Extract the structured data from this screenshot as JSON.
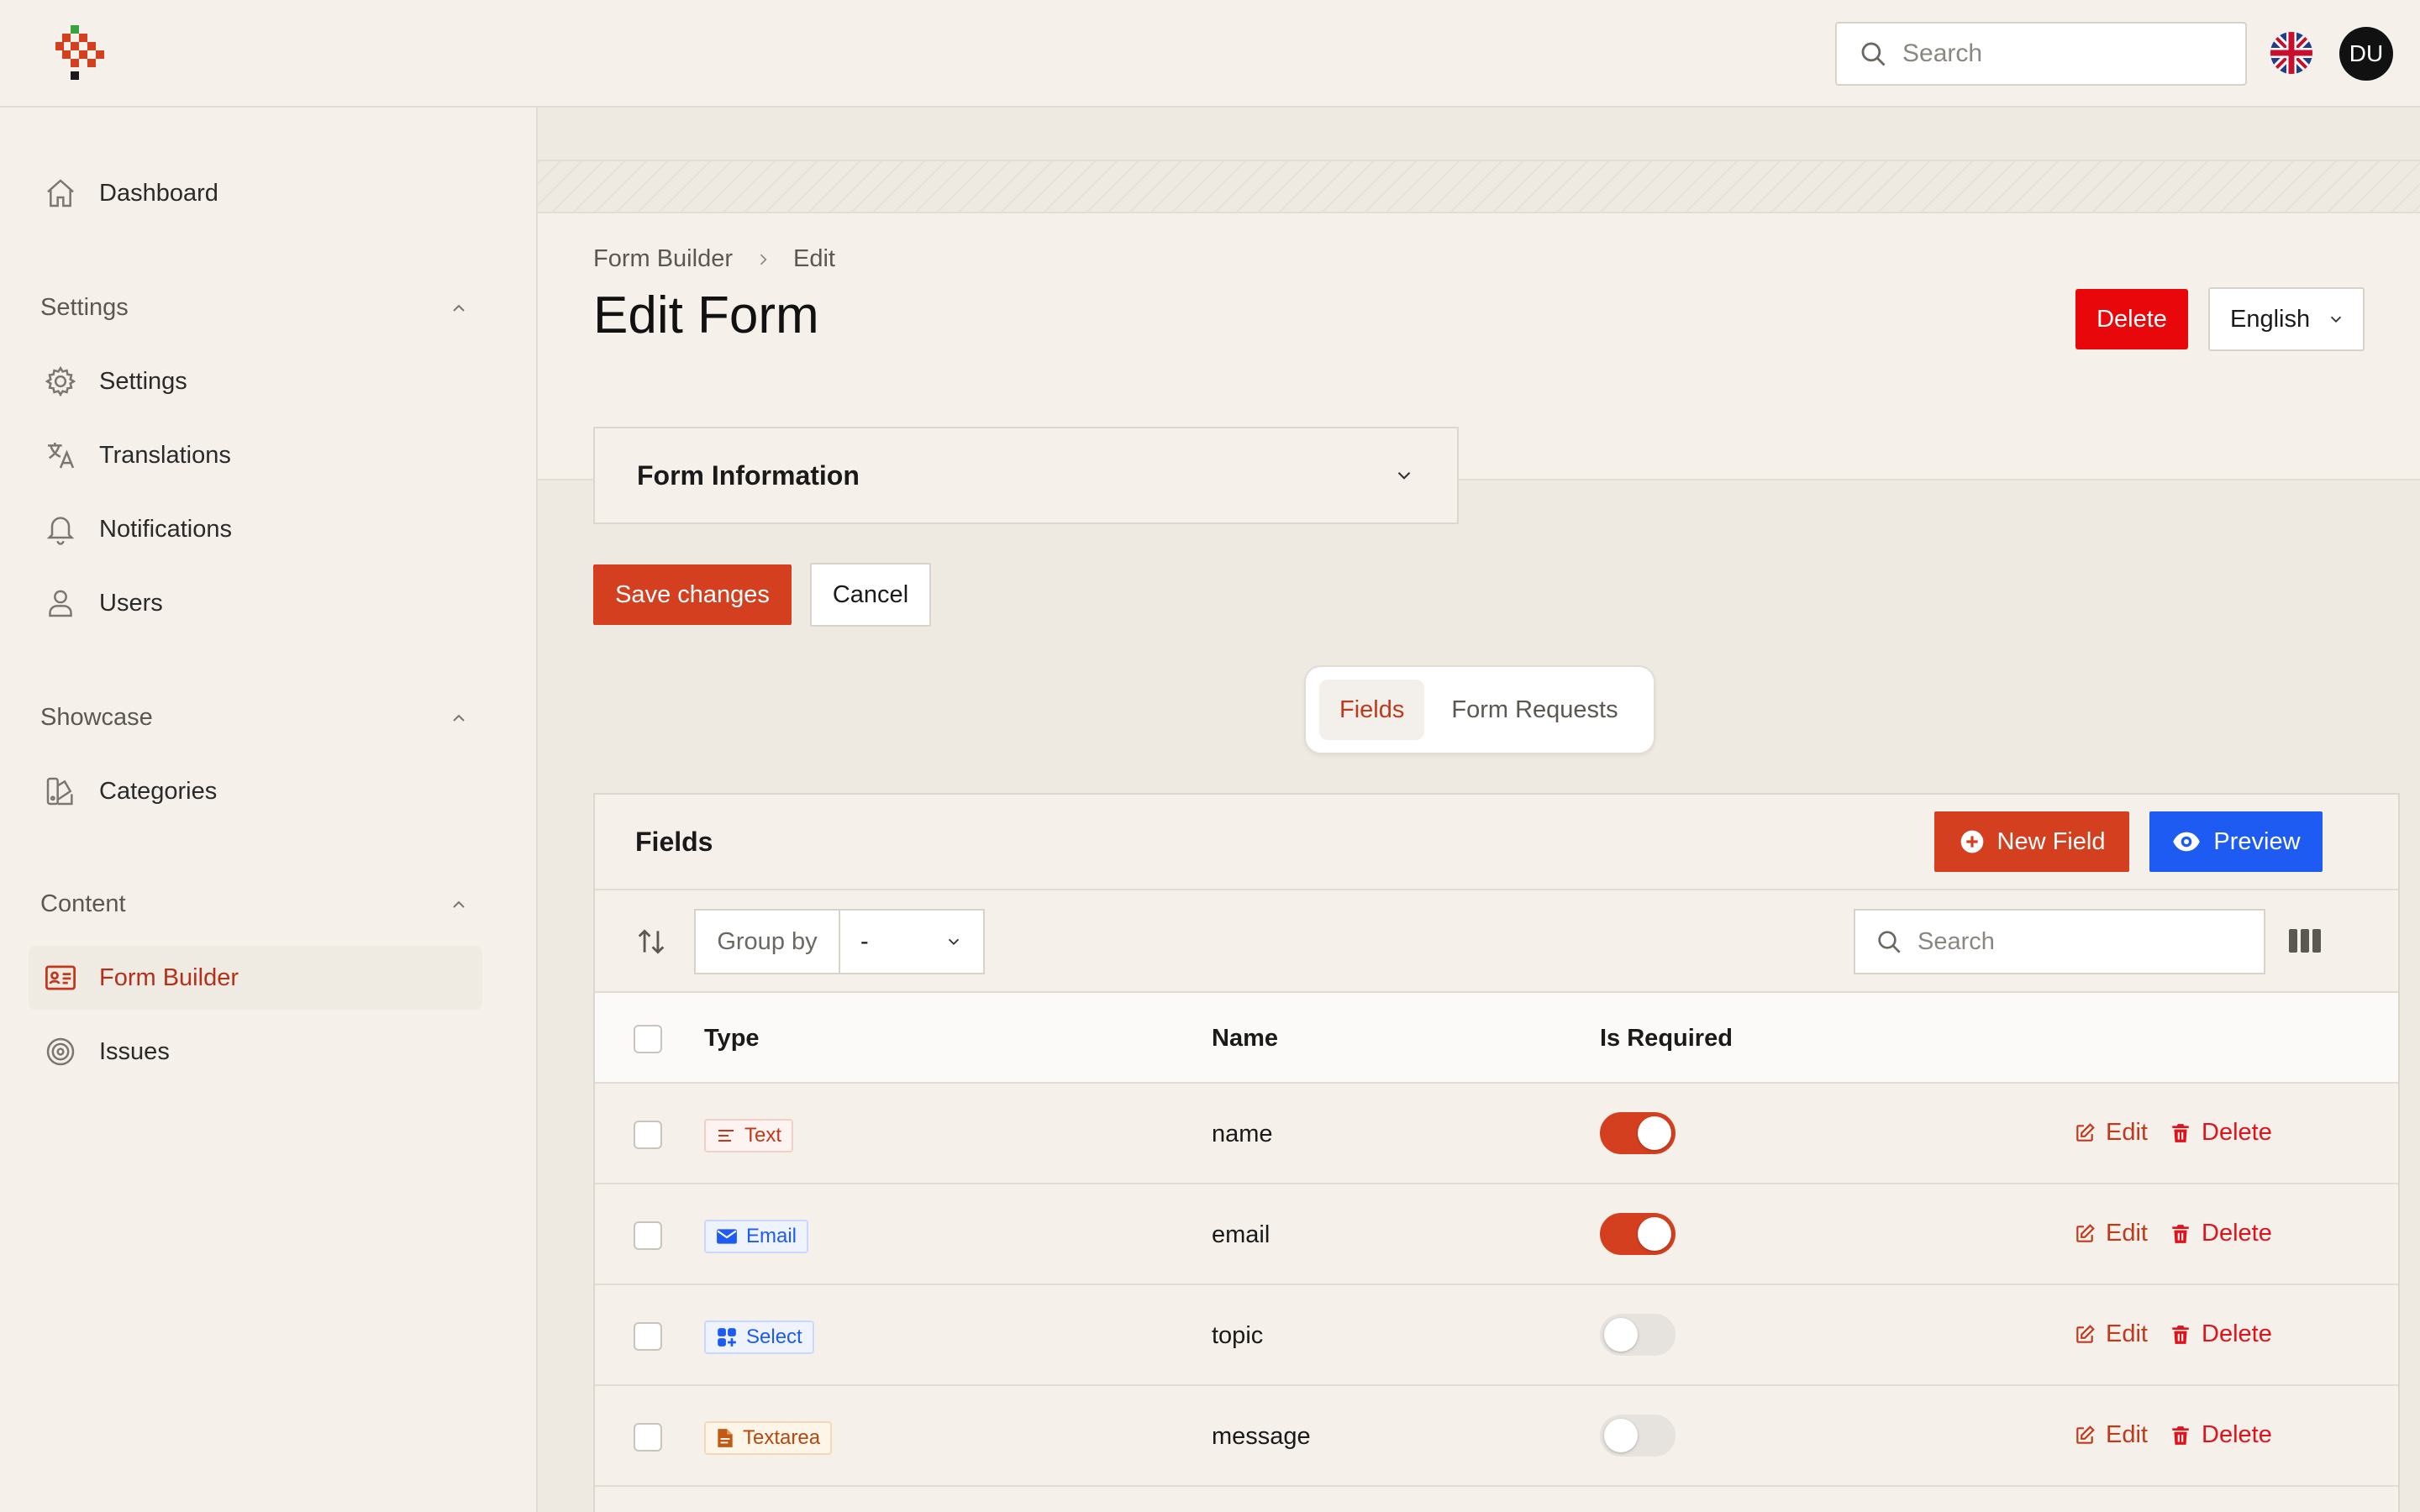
{
  "topbar": {
    "search_placeholder": "Search",
    "avatar_initials": "DU"
  },
  "sidebar": {
    "dashboard": "Dashboard",
    "groups": [
      {
        "label": "Settings",
        "items": [
          "Settings",
          "Translations",
          "Notifications",
          "Users"
        ]
      },
      {
        "label": "Showcase",
        "items": [
          "Categories"
        ]
      },
      {
        "label": "Content",
        "items": [
          "Form Builder",
          "Issues"
        ]
      }
    ],
    "active_item": "Form Builder"
  },
  "header": {
    "breadcrumb": [
      "Form Builder",
      "Edit"
    ],
    "title": "Edit Form",
    "delete_label": "Delete",
    "language_value": "English"
  },
  "form": {
    "accordion_title": "Form Information",
    "save_label": "Save changes",
    "cancel_label": "Cancel"
  },
  "tabs": {
    "items": [
      "Fields",
      "Form Requests"
    ],
    "active": "Fields"
  },
  "fields_table": {
    "title": "Fields",
    "new_field_label": "New Field",
    "preview_label": "Preview",
    "group_by_label": "Group by",
    "group_by_value": "-",
    "search_placeholder": "Search",
    "columns": [
      "Type",
      "Name",
      "Is Required"
    ],
    "rows": [
      {
        "type": "Text",
        "name": "name",
        "required": true,
        "edit": "Edit",
        "delete": "Delete"
      },
      {
        "type": "Email",
        "name": "email",
        "required": true,
        "edit": "Edit",
        "delete": "Delete"
      },
      {
        "type": "Select",
        "name": "topic",
        "required": false,
        "edit": "Edit",
        "delete": "Delete"
      },
      {
        "type": "Textarea",
        "name": "message",
        "required": false,
        "edit": "Edit",
        "delete": "Delete"
      }
    ]
  },
  "colors": {
    "accent": "#d4401f",
    "danger": "#e8080c",
    "primary_blue": "#1d5bf2",
    "background": "#f5f1ea"
  },
  "icons": {
    "type_icons": {
      "Text": "lines-icon",
      "Email": "envelope-icon",
      "Select": "grid-icon",
      "Textarea": "document-icon"
    }
  }
}
